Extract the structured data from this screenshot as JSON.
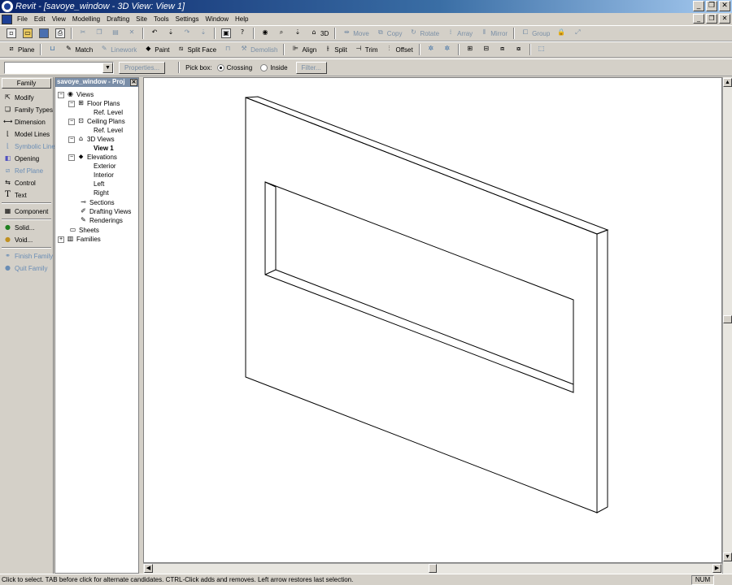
{
  "window": {
    "title": "Revit - [savoye_window - 3D View: View 1]",
    "controls": {
      "minimize": "_",
      "restore": "❐",
      "close": "✕"
    }
  },
  "menu": [
    "File",
    "Edit",
    "View",
    "Modelling",
    "Drafting",
    "Site",
    "Tools",
    "Settings",
    "Window",
    "Help"
  ],
  "toolbar1": {
    "view3d_label": "3D",
    "move_label": "Move",
    "copy_label": "Copy",
    "rotate_label": "Rotate",
    "array_label": "Array",
    "mirror_label": "Mirror",
    "group_label": "Group"
  },
  "toolbar2": {
    "plane_label": "Plane",
    "match_label": "Match",
    "linework_label": "Linework",
    "paint_label": "Paint",
    "splitface_label": "Split Face",
    "demolish_label": "Demolish",
    "align_label": "Align",
    "split_label": "Split",
    "trim_label": "Trim",
    "offset_label": "Offset"
  },
  "options_bar": {
    "type_selector_value": "",
    "properties_label": "Properties...",
    "pickbox_label": "Pick box:",
    "crossing_label": "Crossing",
    "inside_label": "Inside",
    "filter_label": "Filter..."
  },
  "design_bar": {
    "tab_label": "Family",
    "items": [
      {
        "label": "Modify"
      },
      {
        "label": "Family Types"
      },
      {
        "label": "Dimension"
      },
      {
        "label": "Model Lines"
      },
      {
        "label": "Symbolic Line"
      },
      {
        "label": "Opening"
      },
      {
        "label": "Ref Plane"
      },
      {
        "label": "Control"
      },
      {
        "label": "Text"
      },
      {
        "label": "Component"
      },
      {
        "label": "Solid..."
      },
      {
        "label": "Void..."
      },
      {
        "label": "Finish Family"
      },
      {
        "label": "Quit Family"
      }
    ]
  },
  "browser": {
    "title": "savoye_window - Proj",
    "tree": [
      {
        "label": "Views"
      },
      {
        "label": "Floor Plans"
      },
      {
        "label": "Ref. Level"
      },
      {
        "label": "Ceiling Plans"
      },
      {
        "label": "Ref. Level"
      },
      {
        "label": "3D Views"
      },
      {
        "label": "View 1"
      },
      {
        "label": "Elevations"
      },
      {
        "label": "Exterior"
      },
      {
        "label": "Interior"
      },
      {
        "label": "Left"
      },
      {
        "label": "Right"
      },
      {
        "label": "Sections"
      },
      {
        "label": "Drafting Views"
      },
      {
        "label": "Renderings"
      },
      {
        "label": "Sheets"
      },
      {
        "label": "Families"
      }
    ]
  },
  "status": {
    "message": "Click to select. TAB before click for alternate candidates. CTRL-Click adds and removes. Left arrow restores last selection.",
    "num_indicator": "NUM"
  }
}
